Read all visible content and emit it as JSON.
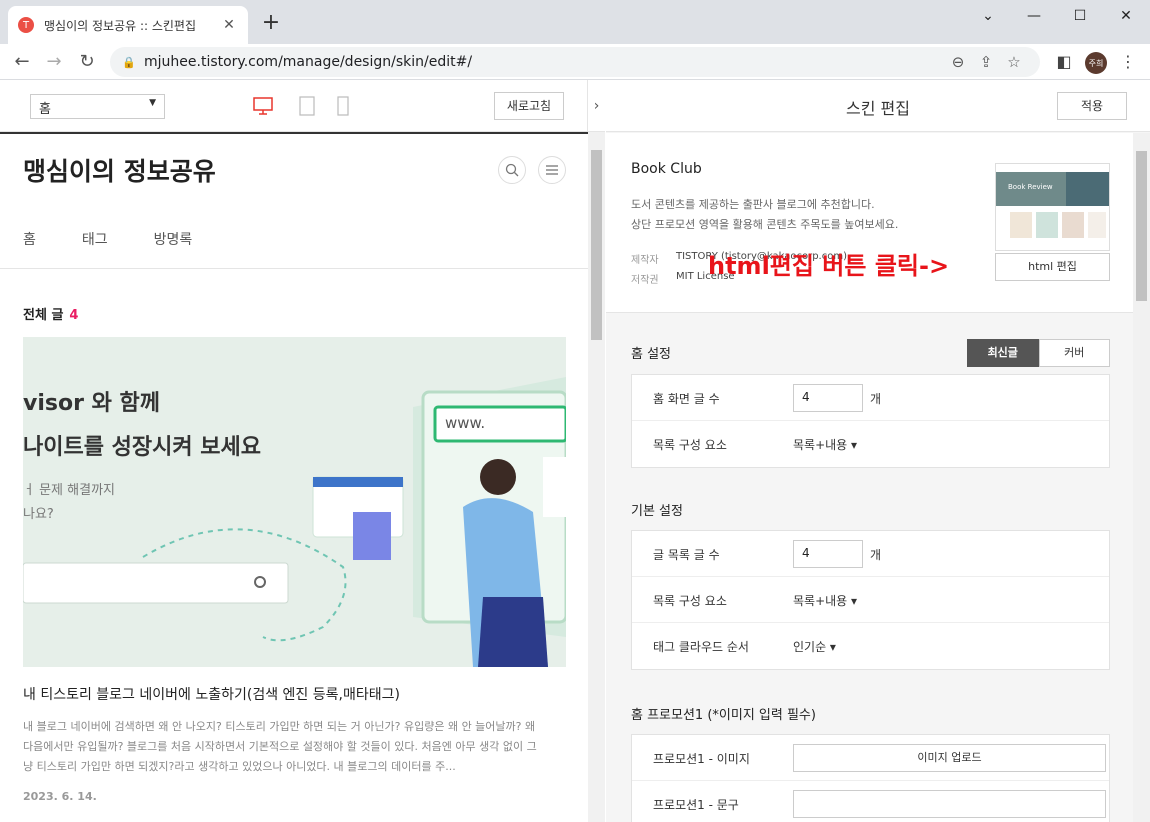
{
  "browser": {
    "tab_title": "맹심이의 정보공유 :: 스킨편집",
    "url": "mjuhee.tistory.com/manage/design/skin/edit#/",
    "avatar_text": "주희"
  },
  "preview_toolbar": {
    "page_select": "홈",
    "refresh_label": "새로고침"
  },
  "blog": {
    "title": "맹심이의 정보공유",
    "nav": [
      "홈",
      "태그",
      "방명록"
    ],
    "all_posts_label": "전체 글",
    "all_posts_count": "4",
    "hero_text": {
      "line1": "visor 와 함께",
      "line2": "나이트를 성장시켜 보세요",
      "line3": "ㅓ 문제 해결까지",
      "line4": "나요?",
      "url_chip": "www."
    },
    "post": {
      "title": "내 티스토리 블로그 네이버에 노출하기(검색 엔진 등록,매타태그)",
      "excerpt": "내 블로그 네이버에 검색하면 왜 안 나오지? 티스토리 가입만 하면 되는 거 아닌가? 유입량은 왜 안 늘어날까? 왜 다음에서만 유입될까? 블로그를 처음 시작하면서 기본적으로 설정해야 할 것들이 있다. 처음엔 아무 생각 없이 그냥 티스토리 가입만 하면 되겠지?라고 생각하고 있었으나 아니었다. 내 블로그의 데이터를 주...",
      "date": "2023. 6. 14."
    }
  },
  "editor": {
    "title": "스킨 편집",
    "apply_label": "적용",
    "skin": {
      "name": "Book Club",
      "desc_line1": "도서 콘텐츠를 제공하는 출판사 블로그에 추천합니다.",
      "desc_line2": "상단 프로모션 영역을 활용해 콘텐츠 주목도를 높여보세요.",
      "maker_label": "제작자",
      "maker_value": "TISTORY (tistory@kakaocorp.com)",
      "license_label": "저작권",
      "license_value": "MIT License",
      "html_edit_label": "html 편집",
      "thumb_text": "Book Review"
    },
    "annotation": "html편집 버튼 클릭->",
    "home_settings": {
      "title": "홈 설정",
      "seg_latest": "최신글",
      "seg_cover": "커버",
      "rows": [
        {
          "label": "홈 화면 글 수",
          "value": "4",
          "unit": "개"
        },
        {
          "label": "목록 구성 요소",
          "select": "목록+내용 ▾"
        }
      ]
    },
    "basic_settings": {
      "title": "기본 설정",
      "rows": [
        {
          "label": "글 목록 글 수",
          "value": "4",
          "unit": "개"
        },
        {
          "label": "목록 구성 요소",
          "select": "목록+내용 ▾"
        },
        {
          "label": "태그 클라우드 순서",
          "select": "인기순 ▾"
        }
      ]
    },
    "promo1": {
      "title": "홈 프로모션1 (*이미지 입력 필수)",
      "rows": [
        {
          "label": "프로모션1 - 이미지",
          "button": "이미지 업로드"
        },
        {
          "label": "프로모션1 - 문구",
          "value": ""
        }
      ]
    }
  }
}
